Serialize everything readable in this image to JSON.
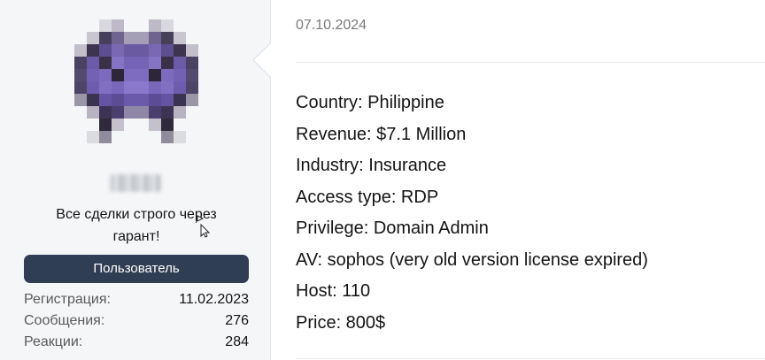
{
  "user": {
    "title_line1": "Все сделки строго через",
    "title_line2": "гарант!",
    "role_banner": "Пользователь",
    "stats": [
      {
        "label": "Регистрация:",
        "value": "11.02.2023"
      },
      {
        "label": "Сообщения:",
        "value": "276"
      },
      {
        "label": "Реакции:",
        "value": "284"
      }
    ]
  },
  "post": {
    "date": "07.10.2024",
    "lines": [
      "Country: Philippine",
      "Revenue: $7.1 Million",
      "Industry: Insurance",
      "Access type: RDP",
      "Privilege: Domain Admin",
      "AV: sophos (very old version license expired)",
      "Host: 110",
      "Price: 800$"
    ]
  },
  "colors": {
    "sidebar_bg": "#f5f6f8",
    "banner_bg": "#2f3e52",
    "avatar_purple": "#5b4a9a"
  },
  "icons": {
    "avatar": "pixelated-avatar",
    "cursor": "move-cursor-icon"
  }
}
